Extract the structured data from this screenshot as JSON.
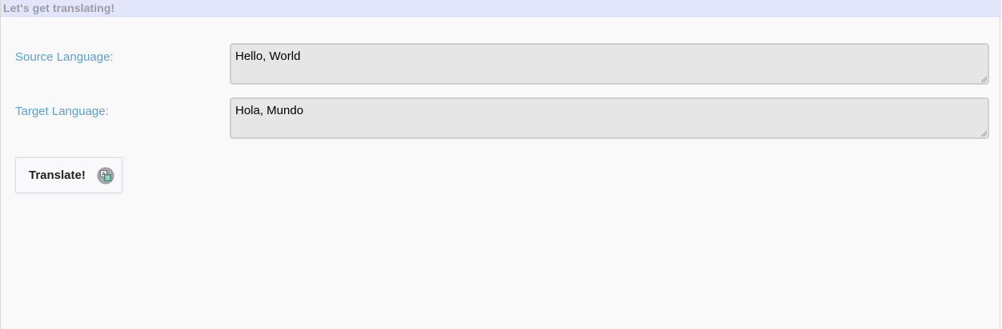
{
  "header": {
    "title": "Let's get translating!"
  },
  "form": {
    "source": {
      "label": "Source Language:",
      "value": "Hello, World"
    },
    "target": {
      "label": "Target Language:",
      "value": "Hola, Mundo"
    },
    "translate_button": {
      "label": "Translate!",
      "icon": "translate-icon"
    }
  },
  "colors": {
    "title_bar_bg": "#e3e6fb",
    "label_color": "#5aa0cf",
    "input_bg": "#e6e6e6",
    "page_bg": "#f9f9f9"
  }
}
